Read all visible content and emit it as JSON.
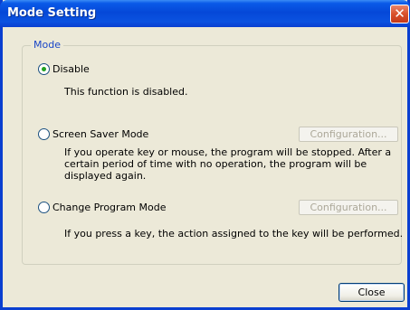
{
  "window": {
    "title": "Mode Setting"
  },
  "mode_group": {
    "label": "Mode",
    "options": [
      {
        "label": "Disable",
        "selected": true,
        "description": "This function is disabled."
      },
      {
        "label": "Screen Saver Mode",
        "selected": false,
        "description": "If you operate key or mouse, the program will be stopped. After a certain period of time with no operation, the program will be displayed again.",
        "config_label": "Configuration...",
        "config_enabled": false
      },
      {
        "label": "Change Program Mode",
        "selected": false,
        "description": "If you press a key, the action assigned to the key will be performed.",
        "config_label": "Configuration...",
        "config_enabled": false
      }
    ]
  },
  "footer": {
    "close_label": "Close"
  }
}
